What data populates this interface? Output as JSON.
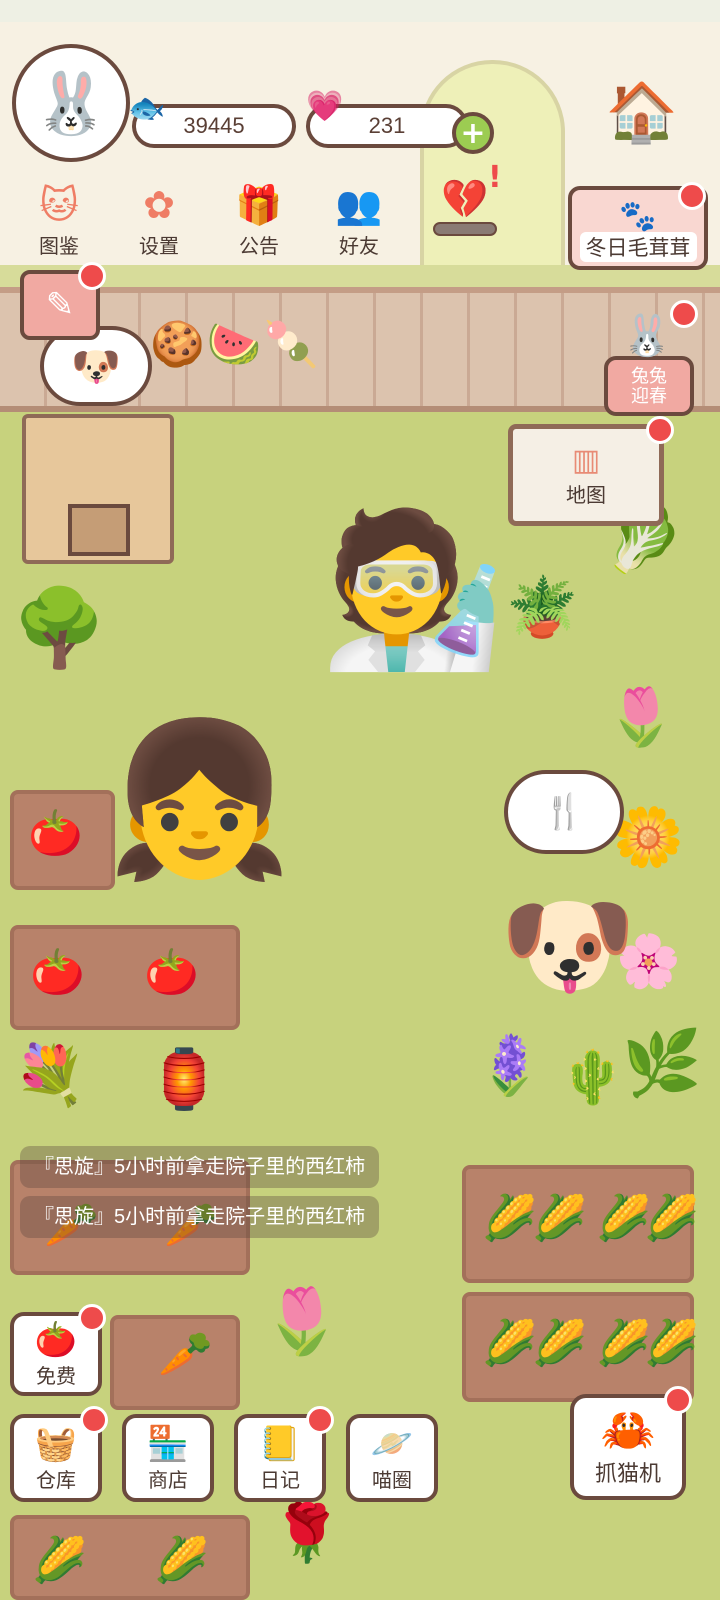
{
  "hud": {
    "fish_coins": "39445",
    "hearts": "231"
  },
  "menu": [
    {
      "label": "图鉴",
      "icon": "cat-book-icon"
    },
    {
      "label": "设置",
      "icon": "gear-icon"
    },
    {
      "label": "公告",
      "icon": "gift-icon"
    },
    {
      "label": "好友",
      "icon": "friends-icon"
    }
  ],
  "event_banner": {
    "label": "冬日毛茸茸",
    "icon": "paw-icon"
  },
  "spring_button": {
    "label_line1": "兔兔",
    "label_line2": "迎春"
  },
  "map_sign": {
    "label": "地图"
  },
  "notifications": [
    "『思旋』5小时前拿走院子里的西红柿",
    "『思旋』5小时前拿走院子里的西红柿"
  ],
  "bottom": {
    "free": "免费",
    "warehouse": "仓库",
    "shop": "商店",
    "diary": "日记",
    "meow_circle": "喵圈",
    "claw_machine": "抓猫机"
  },
  "colors": {
    "accent": "#ef7d65",
    "badge": "#ee4b4b",
    "outline": "#6b4a3e",
    "lawn": "#c7d27d"
  }
}
